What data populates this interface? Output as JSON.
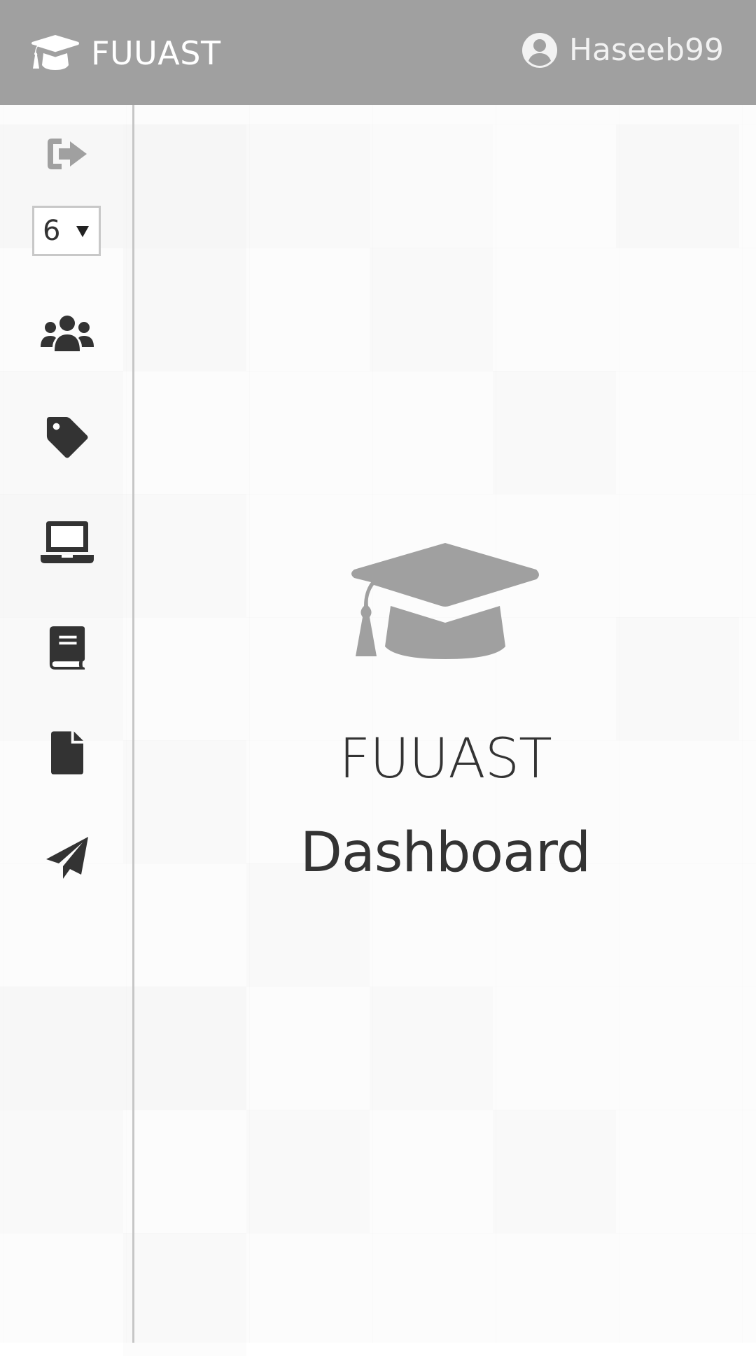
{
  "header": {
    "brand_icon": "graduation-cap-icon",
    "brand_name": "FUUAST",
    "user_icon": "user-circle-icon",
    "username": "Haseeb99"
  },
  "sidebar": {
    "items": [
      {
        "icon": "sign-out-icon",
        "color": "#a0a0a0"
      },
      {
        "type": "select",
        "value": "6"
      },
      {
        "icon": "users-icon",
        "color": "#333333"
      },
      {
        "icon": "tag-icon",
        "color": "#333333"
      },
      {
        "icon": "laptop-icon",
        "color": "#333333"
      },
      {
        "icon": "book-icon",
        "color": "#333333"
      },
      {
        "icon": "file-icon",
        "color": "#333333"
      },
      {
        "icon": "paper-plane-icon",
        "color": "#333333"
      }
    ]
  },
  "main": {
    "hero_icon": "graduation-cap-icon",
    "title": "FUUAST",
    "subtitle": "Dashboard"
  },
  "colors": {
    "header_bg": "#a0a0a0",
    "header_text": "#ffffff",
    "icon_dark": "#333333",
    "icon_muted": "#a0a0a0",
    "text": "#333333"
  }
}
